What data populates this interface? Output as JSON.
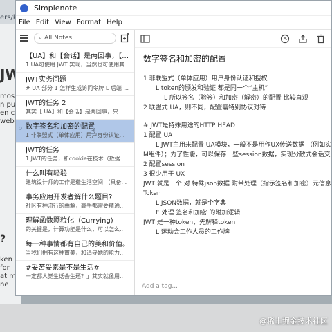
{
  "background": {
    "url_fragment": "ers/ki",
    "heading": "JW",
    "text_lines": [
      "most",
      "n pur",
      "en co",
      "websi"
    ],
    "question_mark": "?",
    "lower_text_lines": [
      "ken",
      "for",
      "at m",
      "ne"
    ],
    "watermark": "@稀土掘金技术社区"
  },
  "window": {
    "title": "Simplenote",
    "menu": [
      "File",
      "Edit",
      "View",
      "Format",
      "Help"
    ]
  },
  "list": {
    "search_placeholder": "All Notes",
    "notes": [
      {
        "title": "【UA】和【会话】是两回事，【U...",
        "preview": "1 UA可使用 JWT 实现，当然也可使用其...",
        "selected": false
      },
      {
        "title": "JWT实务问题",
        "preview": "# UA 部分 1 怎样生成访问令牌 L 后端 ...",
        "selected": false
      },
      {
        "title": "JWT的任务 2",
        "preview": "其实【 UA】和【会话】是两回事，只...",
        "selected": false
      },
      {
        "title": "数字签名和加密的配置",
        "preview": "1 非联盟式（单体应用）用户身份认证...",
        "selected": true
      },
      {
        "title": "JWT的任务",
        "preview": "1 JWT的任务，和cookie在技术（数据载...",
        "selected": false
      },
      {
        "title": "什么叫有轻验",
        "preview": "建筑设计师的工作是造生活空间 （具备...",
        "selected": false
      },
      {
        "title": "事务应用开发者解什么题目?",
        "preview": "社区有种流行的曲解，高手都需要精通...",
        "selected": false
      },
      {
        "title": "理解函数颗粒化（Currying)",
        "preview": "的关键是，计算功能是什么，可以怎么...",
        "selected": false
      },
      {
        "title": "每一种事情都有自己的美和价值。",
        "preview": "当我们拥有这种审美，和追寻她的能力...",
        "selected": false
      },
      {
        "title": "#妥苦妥素是不是生活#",
        "preview": "一定都人觉生话会生还？」其实就像用...",
        "selected": false
      }
    ]
  },
  "editor": {
    "title": "数字签名和加密的配置",
    "lines": [
      {
        "indent": 0,
        "text": "1 非联盟式（单体应用）用户身份认证和授权"
      },
      {
        "indent": 1,
        "text": "L token的颁发和验证 都是同一个“主机”"
      },
      {
        "indent": 2,
        "text": "L 所以签名（验签）和加密（解密）的配置 比较直观"
      },
      {
        "indent": 0,
        "text": "2 联盟式 UA，则不同，配置需特别协议对待"
      },
      {
        "indent": -1,
        "text": ""
      },
      {
        "indent": 0,
        "text": "# JWT是特殊用途的HTTP HEAD"
      },
      {
        "indent": 0,
        "text": "1 配置 UA"
      },
      {
        "indent": 1,
        "text": "L JWT主用来配置 UA模块，一般不是用作UX传送数据 （例如实体"
      },
      {
        "indent": 0,
        "text": "M组件）；为了性能，可以保存一些session数据，实现分散式会话交"
      },
      {
        "indent": 0,
        "text": "2 配置session"
      },
      {
        "indent": 0,
        "text": "3 很少用于 UX"
      },
      {
        "indent": 0,
        "text": "JWT 就是一个 对 特殊json数据 附带处理（指示签名和加密）元信息"
      },
      {
        "indent": 0,
        "text": "Token"
      },
      {
        "indent": 1,
        "text": "L JSON数据，就是个字典"
      },
      {
        "indent": 1,
        "text": "E 处理 签名和加密 的附加逻辑"
      },
      {
        "indent": 0,
        "text": "JWT 是一种token，先解释token"
      },
      {
        "indent": 1,
        "text": "L 运动会工作人员的工作牌"
      }
    ],
    "tag_placeholder": "Add a tag..."
  },
  "colors": {
    "accent": "#3361cc",
    "selected_row": "#b0c7e8"
  }
}
